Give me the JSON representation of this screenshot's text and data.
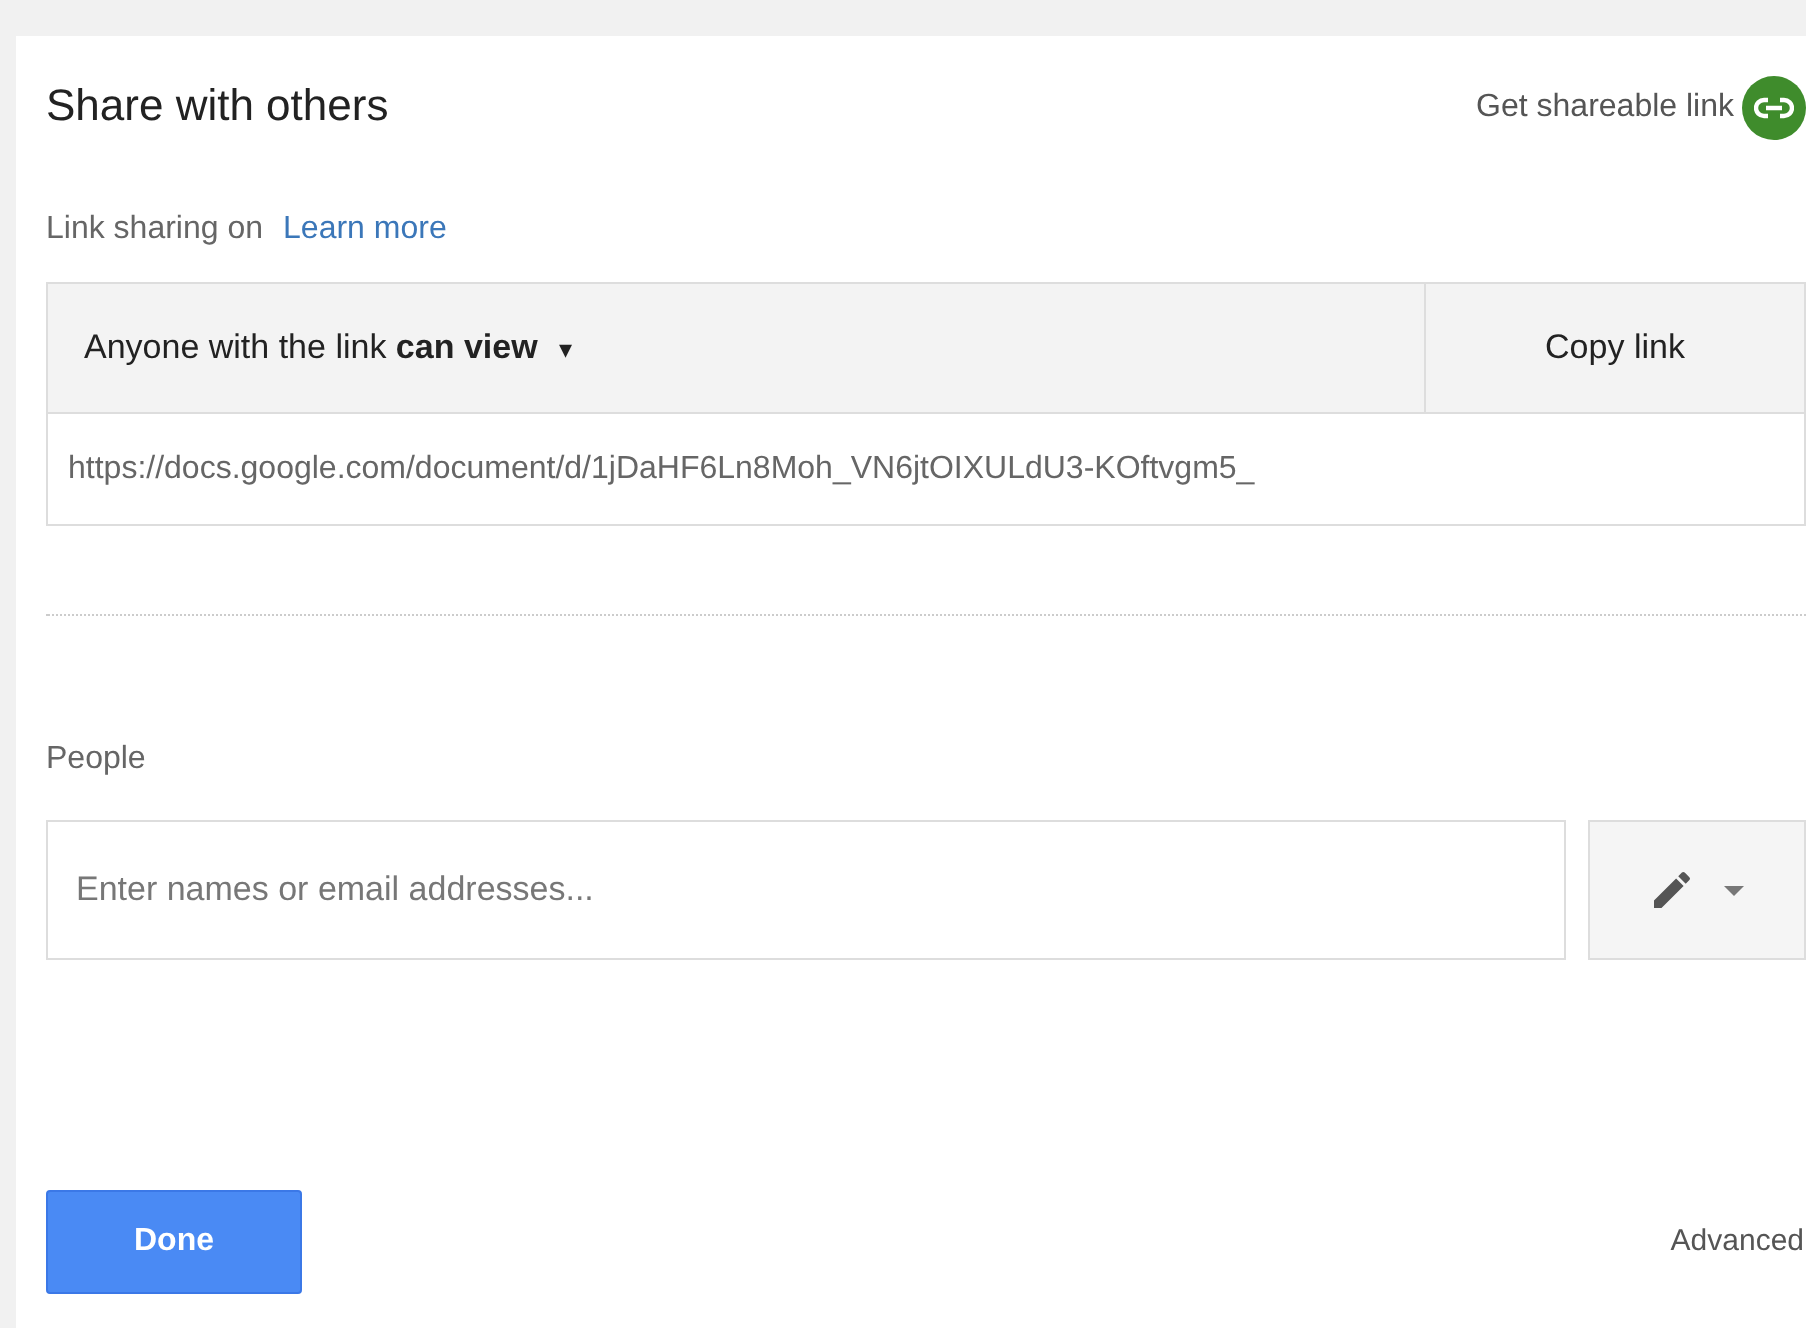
{
  "dialog": {
    "title": "Share with others",
    "get_link": "Get shareable link"
  },
  "link_sharing": {
    "status": "Link sharing on",
    "learn_more": "Learn more",
    "access": "Anyone with the link **can view**",
    "dropdown_arrow": "▾",
    "copy_button": "Copy link",
    "url": "https://docs.google.com/document/d/1jDaHF6Ln8Moh_VN6jtOIXULdU3-KOftvgm5_"
  },
  "people": {
    "label": "People",
    "placeholder": "Enter names or email addresses..."
  },
  "footer": {
    "done": "Done",
    "advanced": "Advanced"
  }
}
